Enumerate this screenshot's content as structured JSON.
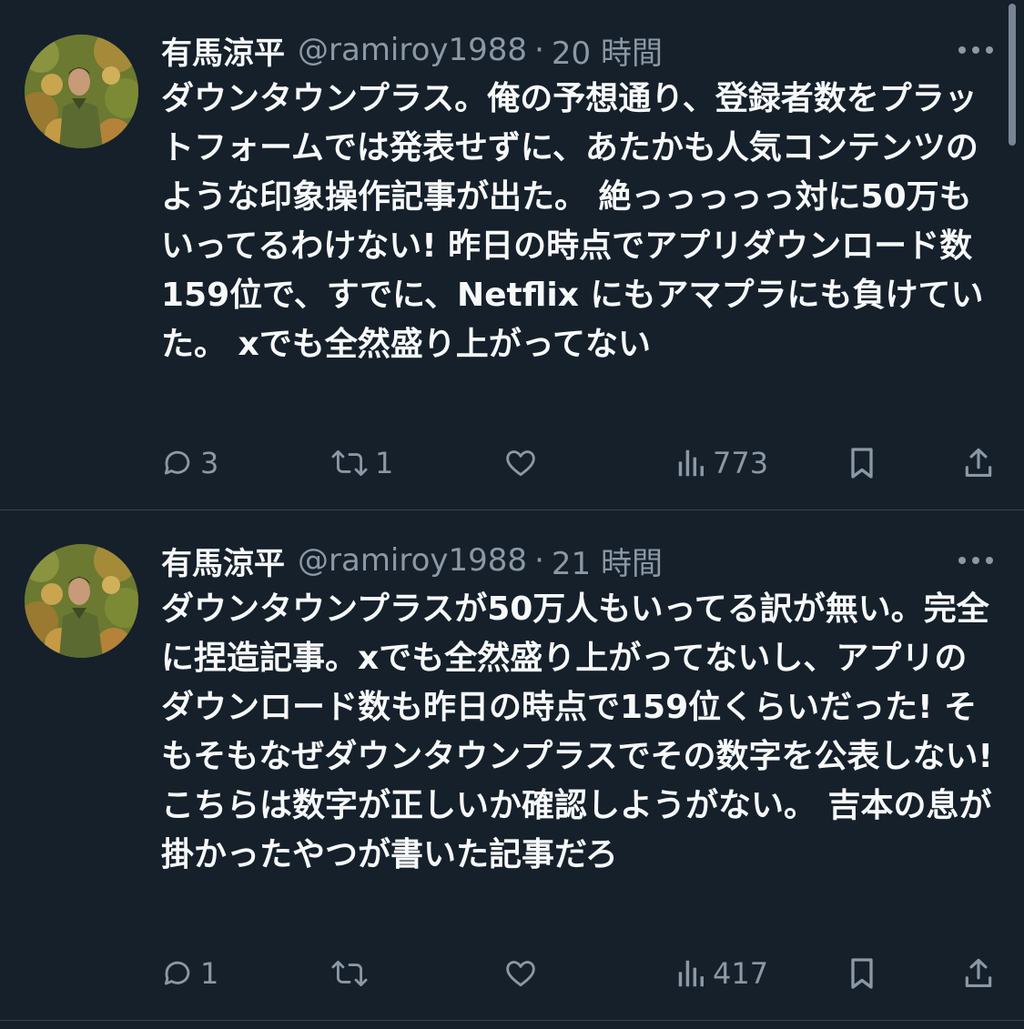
{
  "tweets": [
    {
      "display_name": "有馬涼平",
      "handle": "@ramiroy1988",
      "separator": "·",
      "time": "20 時間",
      "text": "ダウンタウンプラス。俺の予想通り、登録者数をプラットフォームでは発表せずに、あたかも人気コンテンツのような印象操作記事が出た。 絶っっっっっ対に50万もいってるわけない! 昨日の時点でアプリダウンロード数159位で、すでに、Netflix にもアマプラにも負けていた。 xでも全然盛り上がってない",
      "replies": "3",
      "retweets": "1",
      "likes": "",
      "views": "773",
      "icons": [
        "reply-icon",
        "retweet-icon",
        "like-icon",
        "views-icon",
        "bookmark-icon",
        "share-icon",
        "more-icon"
      ]
    },
    {
      "display_name": "有馬涼平",
      "handle": "@ramiroy1988",
      "separator": "·",
      "time": "21 時間",
      "text": "ダウンタウンプラスが50万人もいってる訳が無い。完全に捏造記事。xでも全然盛り上がってないし、アプリのダウンロード数も昨日の時点で159位くらいだった! そもそもなぜダウンタウンプラスでその数字を公表しない! こちらは数字が正しいか確認しようがない。 吉本の息が掛かったやつが書いた記事だろ",
      "replies": "1",
      "retweets": "",
      "likes": "",
      "views": "417",
      "icons": [
        "reply-icon",
        "retweet-icon",
        "like-icon",
        "views-icon",
        "bookmark-icon",
        "share-icon",
        "more-icon"
      ]
    }
  ],
  "colors": {
    "background": "#15202b",
    "text_primary": "#f7f9f9",
    "text_secondary": "#8b98a5",
    "divider": "#38444d"
  }
}
